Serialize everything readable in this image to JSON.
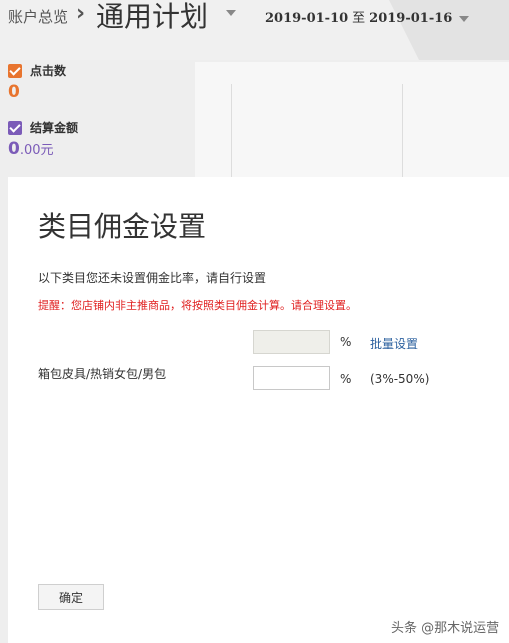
{
  "header": {
    "breadcrumb": "账户总览",
    "plan_title": "通用计划",
    "date_start": "2019-01-10",
    "date_separator": "至",
    "date_end": "2019-01-16"
  },
  "metrics": [
    {
      "label": "点击数",
      "value": "0",
      "color": "#e8742e"
    },
    {
      "label": "结算金额",
      "value_int": "0",
      "value_dec": ".00元",
      "color": "#7b5bb8"
    }
  ],
  "modal": {
    "title": "类目佣金设置",
    "info": "以下类目您还未设置佣金比率，请自行设置",
    "warning": "提醒：您店铺内非主推商品，将按照类目佣金计算。请合理设置。",
    "batch_unit": "%",
    "batch_link": "批量设置",
    "category": "箱包皮具/热销女包/男包",
    "category_unit": "%",
    "range_hint": "(3%-50%)",
    "confirm_label": "确定"
  },
  "watermark": "头条 @那木说运营"
}
